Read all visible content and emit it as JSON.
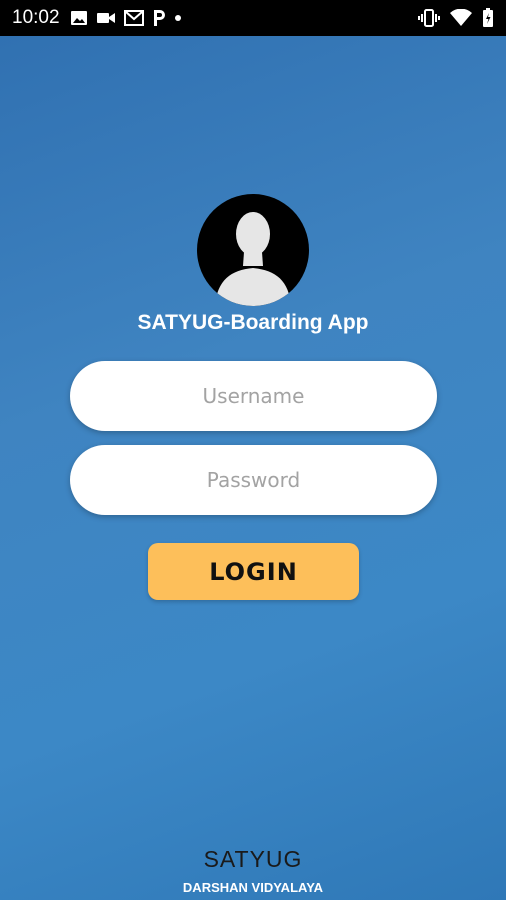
{
  "status_bar": {
    "time": "10:02",
    "left_icons": [
      "image-icon",
      "video-camera-icon",
      "gmail-icon",
      "parking-app-icon",
      "dot-icon"
    ],
    "right_icons": [
      "vibrate-icon",
      "wifi-icon",
      "battery-icon"
    ]
  },
  "app": {
    "title": "SATYUG-Boarding App"
  },
  "form": {
    "username_placeholder": "Username",
    "username_value": "",
    "password_placeholder": "Password",
    "password_value": "",
    "login_label": "LOGIN"
  },
  "footer": {
    "brand": "SATYUG",
    "sub": "DARSHAN VIDYALAYA"
  },
  "colors": {
    "background": "#3c88c6",
    "login_button": "#fdbf5a",
    "status_bar": "#000000"
  }
}
